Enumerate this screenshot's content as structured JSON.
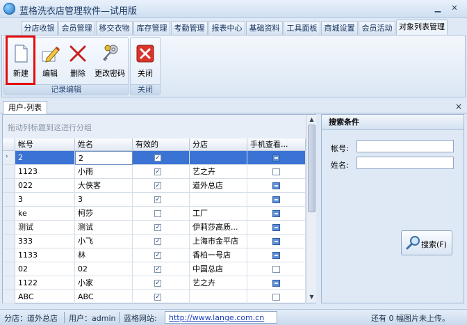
{
  "window": {
    "title": "蓝格洗衣店管理软件—试用版"
  },
  "tabs": [
    {
      "label": "分店收银"
    },
    {
      "label": "会员管理"
    },
    {
      "label": "移交衣物"
    },
    {
      "label": "库存管理"
    },
    {
      "label": "考勤管理"
    },
    {
      "label": "报表中心"
    },
    {
      "label": "基础资料"
    },
    {
      "label": "工具面板"
    },
    {
      "label": "商城设置"
    },
    {
      "label": "会员活动"
    },
    {
      "label": "对象列表管理"
    }
  ],
  "ribbon": {
    "group1": {
      "label": "记录编辑",
      "buttons": [
        {
          "label": "新建"
        },
        {
          "label": "编辑"
        },
        {
          "label": "删除"
        },
        {
          "label": "更改密码"
        }
      ]
    },
    "group2": {
      "label": "关闭",
      "buttons": [
        {
          "label": "关闭"
        }
      ]
    }
  },
  "doc": {
    "tab_label": "用户-列表",
    "close": "×"
  },
  "grid": {
    "group_hint": "拖动列标题到这进行分组",
    "columns": [
      "帐号",
      "姓名",
      "有效的",
      "分店",
      "手机查看..."
    ],
    "rows": [
      {
        "account": "2",
        "name": "2",
        "store": "",
        "valid": true,
        "mobile": true
      },
      {
        "account": "1123",
        "name": "小雨",
        "store": "艺之卉",
        "valid": true,
        "mobile": false
      },
      {
        "account": "022",
        "name": "大侠客",
        "store": "道外总店",
        "valid": true,
        "mobile": true
      },
      {
        "account": "3",
        "name": "3",
        "store": "",
        "valid": true,
        "mobile": true
      },
      {
        "account": "ke",
        "name": "柯莎",
        "store": "工厂",
        "valid": false,
        "mobile": true
      },
      {
        "account": "测试",
        "name": "测试",
        "store": "伊莉莎高质...",
        "valid": true,
        "mobile": true
      },
      {
        "account": "333",
        "name": "小飞",
        "store": "上海市金平店",
        "valid": true,
        "mobile": true
      },
      {
        "account": "1133",
        "name": "林",
        "store": "香柏一号店",
        "valid": true,
        "mobile": true
      },
      {
        "account": "02",
        "name": "02",
        "store": "中国总店",
        "valid": true,
        "mobile": false
      },
      {
        "account": "1122",
        "name": "小家",
        "store": "艺之卉",
        "valid": true,
        "mobile": true
      },
      {
        "account": "ABC",
        "name": "ABC",
        "store": "",
        "valid": true,
        "mobile": false
      }
    ]
  },
  "search": {
    "title": "搜索条件",
    "account_label": "帐号:",
    "name_label": "姓名:",
    "account_value": "",
    "name_value": "",
    "button_label": "搜索(F)"
  },
  "status": {
    "store": "分店：道外总店",
    "user": "用户：admin",
    "site_label": "蓝格网站:",
    "url": "http://www.lange.com.cn",
    "upload": "还有 0 幅图片未上传。"
  },
  "colors": {
    "selected_row": "#3a73d4",
    "highlight_box": "#e20c0c"
  }
}
